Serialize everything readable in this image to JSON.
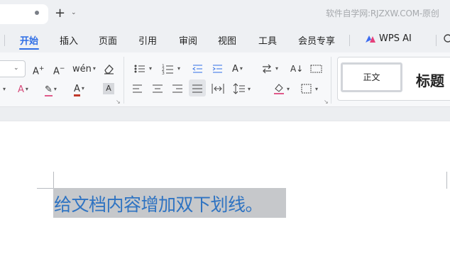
{
  "titlebar": {
    "new_tab_symbol": "+",
    "new_tab_arrow": "⌄",
    "watermark": "软件自学网:RJZXW.COM-原创"
  },
  "menu": {
    "items": [
      "开始",
      "插入",
      "页面",
      "引用",
      "审阅",
      "视图",
      "工具",
      "会员专享"
    ],
    "wps_ai": "WPS AI",
    "active_color": "#2f6ee6"
  },
  "ribbon": {
    "font_size_value": "",
    "icons": {
      "row1": [
        "grow-font-icon",
        "shrink-font-icon",
        "phonetic-guide-icon",
        "clear-format-icon",
        "bullet-list-icon",
        "numbered-list-icon",
        "decrease-indent-icon",
        "increase-indent-icon",
        "text-direction-icon",
        "sort-icon",
        "line-break-icon",
        "table-border-icon"
      ],
      "row2": [
        "font-effect-icon",
        "highlight-icon",
        "font-color-icon",
        "char-shading-icon",
        "align-left-icon",
        "align-center-icon",
        "align-right-icon",
        "justify-icon",
        "distribute-icon",
        "line-spacing-icon",
        "shading-icon",
        "border-icon"
      ]
    },
    "styles": {
      "normal": "正文",
      "heading": "标题"
    }
  },
  "document": {
    "text": "给文档内容增加双下划线。",
    "text_color": "#2e73c2",
    "selection_color": "#c6c8cb"
  }
}
